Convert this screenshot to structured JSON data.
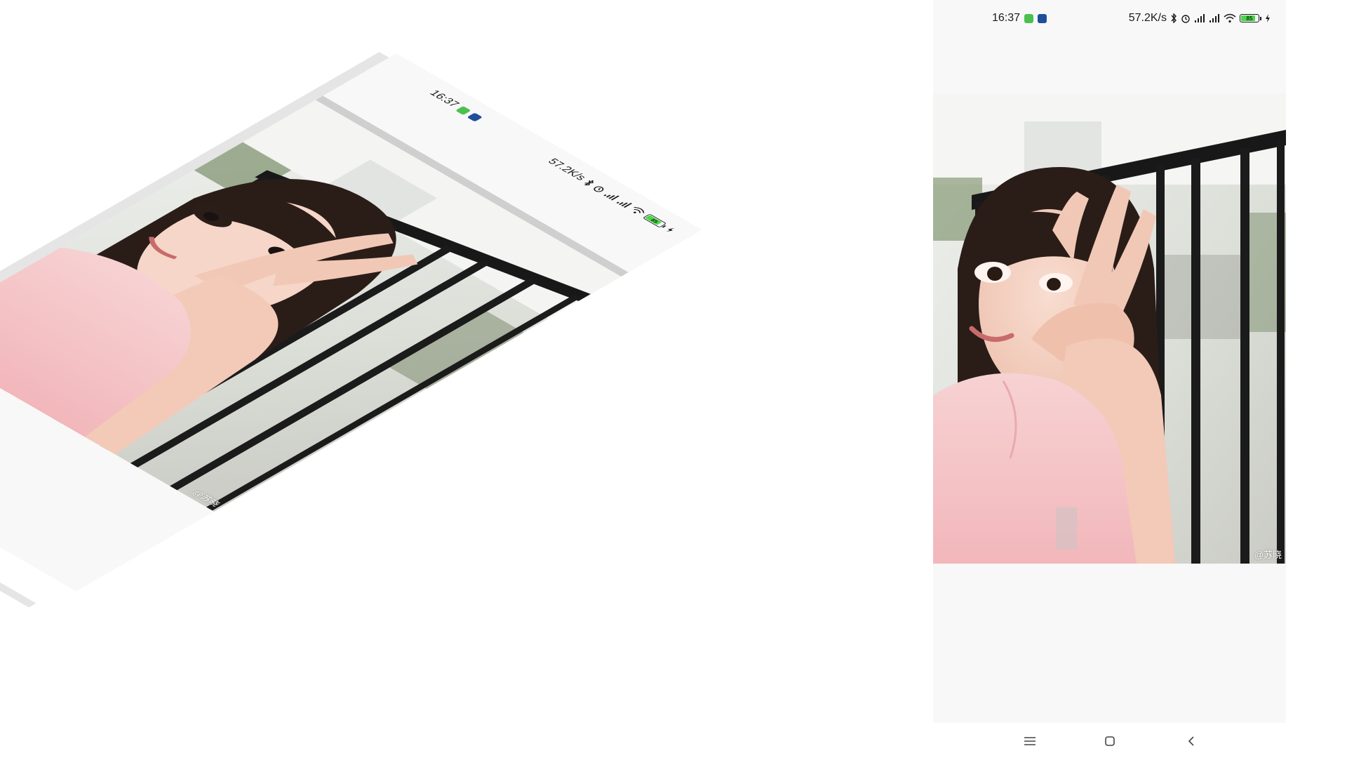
{
  "status_bar": {
    "time": "16:37",
    "network_speed": "57.2K/s",
    "icons": [
      "bluetooth-icon",
      "alarm-icon",
      "hd-signal-icon",
      "hd-signal-icon",
      "wifi-icon",
      "battery-icon",
      "charging-icon"
    ],
    "battery_level": "85",
    "battery_fraction": 0.85,
    "battery_color": "#4ad64a",
    "notification_colors": [
      "#4cc04f",
      "#1f4f9a"
    ]
  },
  "viewer": {
    "photo_description": "girl-in-pink-by-balcony-railing",
    "watermark": "@苏晓"
  },
  "nav_bar": {
    "icons": [
      "menu-icon",
      "home-icon",
      "back-icon"
    ]
  },
  "colors": {
    "screen_background": "#f8f8f8",
    "page_background": "#ffffff"
  }
}
